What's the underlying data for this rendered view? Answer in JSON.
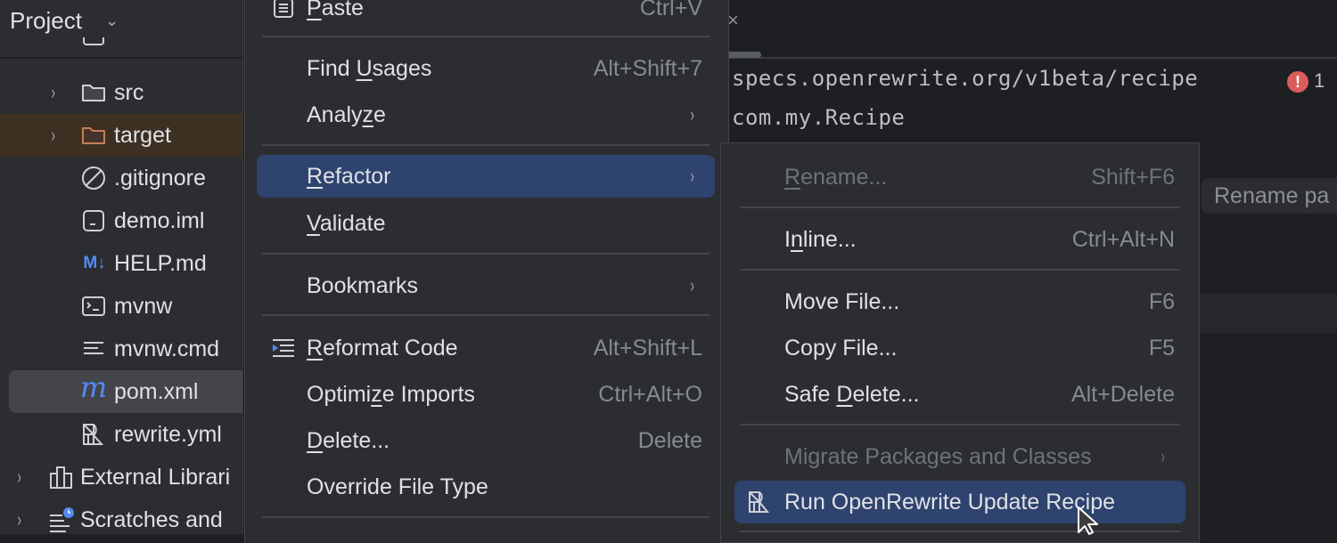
{
  "project_panel": {
    "title": "Project",
    "tree": [
      {
        "label": "src",
        "icon": "folder-icon",
        "expandable": true
      },
      {
        "label": "target",
        "icon": "folder-excluded-icon",
        "expandable": true,
        "highlighted": true
      },
      {
        "label": ".gitignore",
        "icon": "ignore-file-icon"
      },
      {
        "label": "demo.iml",
        "icon": "module-file-icon"
      },
      {
        "label": "HELP.md",
        "icon": "markdown-icon",
        "icon_text": "M↓"
      },
      {
        "label": "mvnw",
        "icon": "shell-script-icon"
      },
      {
        "label": "mvnw.cmd",
        "icon": "text-file-icon"
      },
      {
        "label": "pom.xml",
        "icon": "maven-icon",
        "icon_text": "m",
        "selected": true
      },
      {
        "label": "rewrite.yml",
        "icon": "openrewrite-icon"
      },
      {
        "label": "External Librari",
        "icon": "library-icon",
        "expandable": true
      },
      {
        "label": "Scratches and",
        "icon": "scratches-icon",
        "expandable": true
      }
    ]
  },
  "editor": {
    "code_lines": [
      "specs.openrewrite.org/v1beta/recipe",
      "com.my.Recipe"
    ],
    "error_count": "1",
    "error_icon_glyph": "!",
    "rename_hint": "Rename pa",
    "tab_close_glyph": "×"
  },
  "context_menu": {
    "items": [
      {
        "label_pre": "",
        "mnemonic": "P",
        "label_post": "aste",
        "shortcut": "Ctrl+V",
        "icon": "paste-icon"
      },
      {
        "label_pre": "Find ",
        "mnemonic": "U",
        "label_post": "sages",
        "shortcut": "Alt+Shift+7"
      },
      {
        "label_pre": "Analy",
        "mnemonic": "z",
        "label_post": "e",
        "submenu": true
      },
      {
        "label_pre": "",
        "mnemonic": "R",
        "label_post": "efactor",
        "submenu": true,
        "active": true
      },
      {
        "label_pre": "",
        "mnemonic": "V",
        "label_post": "alidate"
      },
      {
        "label_pre": "Bookmarks",
        "mnemonic": "",
        "label_post": "",
        "submenu": true
      },
      {
        "label_pre": "",
        "mnemonic": "R",
        "label_post": "eformat Code",
        "shortcut": "Alt+Shift+L",
        "icon": "reformat-icon"
      },
      {
        "label_pre": "Optimi",
        "mnemonic": "z",
        "label_post": "e Imports",
        "shortcut": "Ctrl+Alt+O"
      },
      {
        "label_pre": "",
        "mnemonic": "D",
        "label_post": "elete...",
        "shortcut": "Delete"
      },
      {
        "label_pre": "Override File Type",
        "mnemonic": "",
        "label_post": ""
      }
    ]
  },
  "refactor_submenu": {
    "items": [
      {
        "label_pre": "",
        "mnemonic": "R",
        "label_post": "ename...",
        "shortcut": "Shift+F6",
        "disabled": true
      },
      {
        "label_pre": "I",
        "mnemonic": "n",
        "label_post": "line...",
        "shortcut": "Ctrl+Alt+N"
      },
      {
        "label_pre": "Move File...",
        "mnemonic": "",
        "label_post": "",
        "shortcut": "F6"
      },
      {
        "label_pre": "Copy File...",
        "mnemonic": "",
        "label_post": "",
        "shortcut": "F5"
      },
      {
        "label_pre": "Safe ",
        "mnemonic": "D",
        "label_post": "elete...",
        "shortcut": "Alt+Delete"
      },
      {
        "label_pre": "Migrate Packages and Classes",
        "mnemonic": "",
        "label_post": "",
        "submenu": true,
        "disabled": true
      },
      {
        "label_pre": "Run OpenRewrite Update Recipe",
        "mnemonic": "",
        "label_post": "",
        "active": true,
        "icon": "openrewrite-icon"
      }
    ]
  },
  "glyphs": {
    "chevron_right": "›",
    "chevron_down": "⌄",
    "expand_arrow": "›"
  },
  "colors": {
    "accent_selection": "#2e436e",
    "error": "#db5c5c",
    "markdown_blue": "#548af7"
  }
}
